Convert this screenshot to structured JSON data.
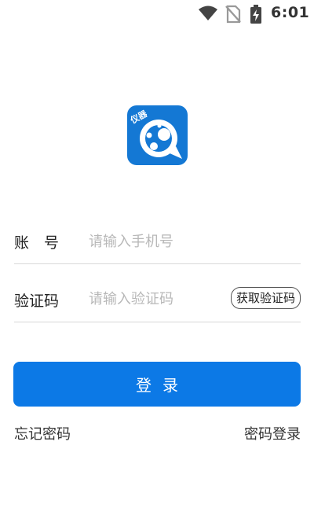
{
  "status_bar": {
    "time": "6:01",
    "icons": [
      "wifi-icon",
      "no-sim-icon",
      "battery-charging-icon"
    ]
  },
  "logo": {
    "icon": "app-logo-icon",
    "badge_text": "仪器",
    "colors": {
      "background": "#1478d4",
      "foreground": "#ffffff"
    }
  },
  "form": {
    "account": {
      "label": "账　号",
      "placeholder": "请输入手机号",
      "value": ""
    },
    "code": {
      "label": "验证码",
      "placeholder": "请输入验证码",
      "value": "",
      "get_code_label": "获取验证码"
    }
  },
  "login_button": {
    "label": "登录",
    "color": "#0c79e6"
  },
  "links": {
    "forgot_password": "忘记密码",
    "password_login": "密码登录"
  }
}
